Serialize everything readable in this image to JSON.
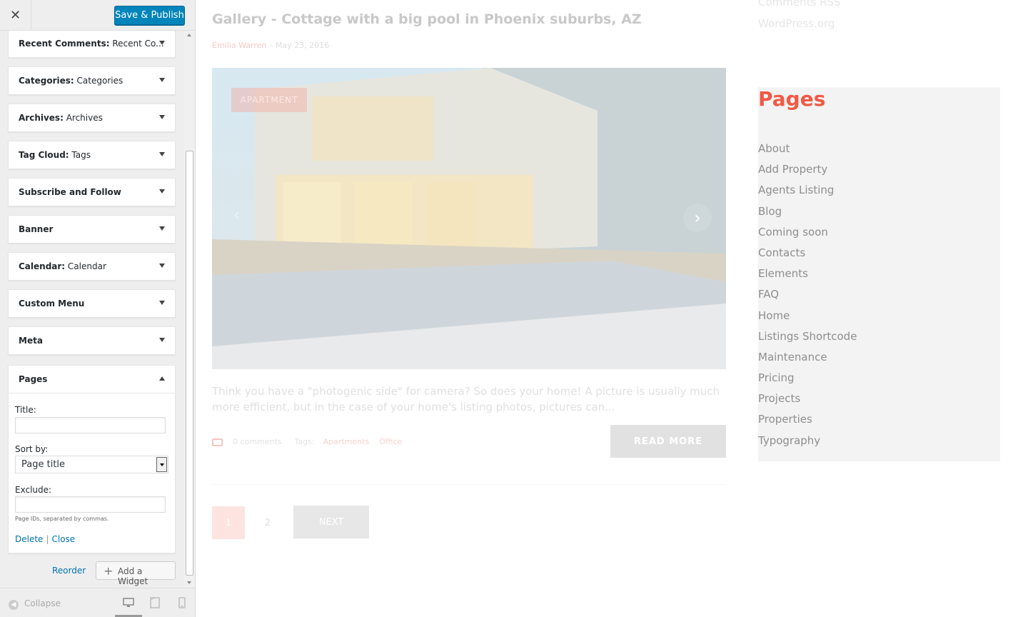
{
  "topbar": {
    "close_label": "✕",
    "publish_label": "Save & Publish"
  },
  "widgets": [
    {
      "bold": "Recent Comments:",
      "sub": " Recent Co..."
    },
    {
      "bold": "Categories:",
      "sub": " Categories"
    },
    {
      "bold": "Archives:",
      "sub": " Archives"
    },
    {
      "bold": "Tag Cloud:",
      "sub": " Tags"
    },
    {
      "bold": "Subscribe and Follow",
      "sub": ""
    },
    {
      "bold": "Banner",
      "sub": ""
    },
    {
      "bold": "Calendar:",
      "sub": " Calendar"
    },
    {
      "bold": "Custom Menu",
      "sub": ""
    },
    {
      "bold": "Meta",
      "sub": ""
    }
  ],
  "pages_widget": {
    "title": "Pages",
    "title_label": "Title:",
    "title_value": "",
    "sort_label": "Sort by:",
    "sort_value": "Page title",
    "exclude_label": "Exclude:",
    "exclude_value": "",
    "exclude_hint": "Page IDs, separated by commas.",
    "delete_label": "Delete",
    "separator": "|",
    "close_label": "Close"
  },
  "sidebar_actions": {
    "reorder": "Reorder",
    "add_widget": "Add a Widget"
  },
  "footer": {
    "collapse": "Collapse"
  },
  "preview": {
    "post_title": "Gallery - Cottage with a big pool in Phoenix suburbs, AZ",
    "author": "Emilia Warren",
    "meta_sep": " – ",
    "date": "May 23, 2016",
    "badge": "APARTMENT",
    "excerpt": "Think you have a \"photogenic side\" for camera? So does your home! A picture is usually much more efficient, but in the case of your home's listing photos, pictures can...",
    "comments": "0 comments",
    "tags_label": "Tags:",
    "tags": [
      "Apartments",
      "Office"
    ],
    "read_more": "READ MORE",
    "pagination": {
      "current": "1",
      "second": "2",
      "next": "NEXT"
    },
    "side_links_top": [
      "Comments RSS",
      "WordPress.org"
    ],
    "pages_heading": "Pages",
    "pages": [
      "About",
      "Add Property",
      "Agents Listing",
      "Blog",
      "Coming soon",
      "Contacts",
      "Elements",
      "FAQ",
      "Home",
      "Listings Shortcode",
      "Maintenance",
      "Pricing",
      "Projects",
      "Properties",
      "Typography"
    ],
    "accent": "#f15a45"
  },
  "colors": {
    "publish": "#0085ba",
    "link": "#0073aa"
  }
}
